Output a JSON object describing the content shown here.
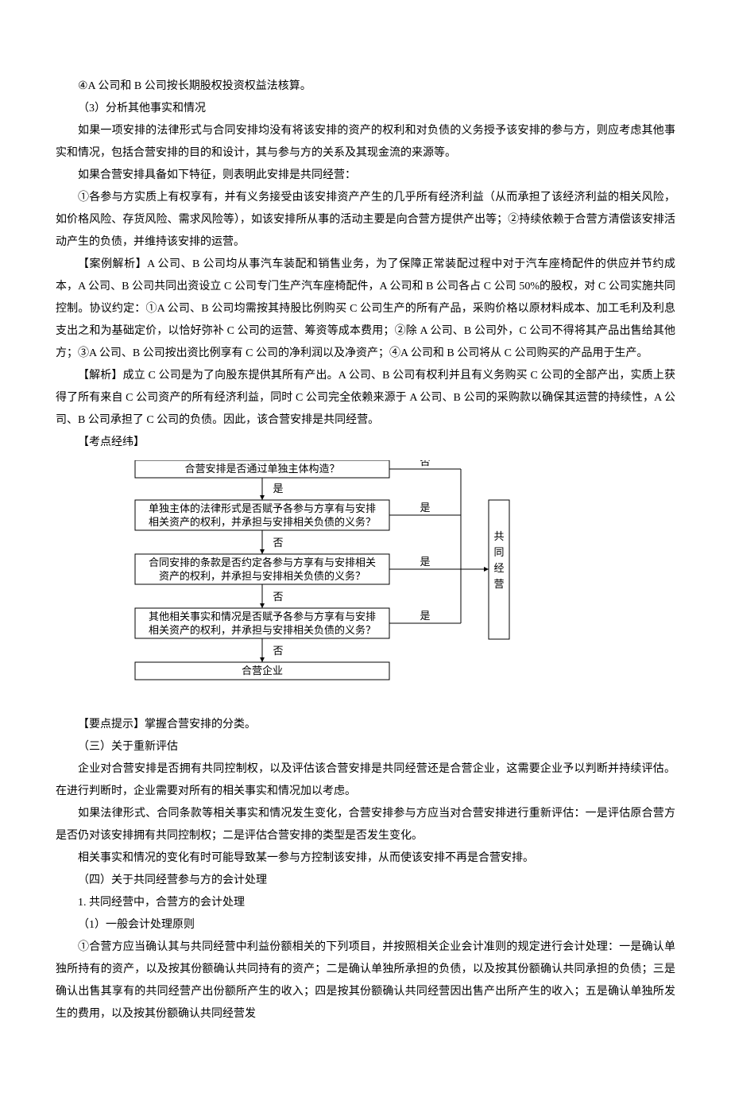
{
  "paragraphs": {
    "p1": "④A 公司和 B 公司按长期股权投资权益法核算。",
    "p2": "（3）分析其他事实和情况",
    "p3": "如果一项安排的法律形式与合同安排均没有将该安排的资产的权利和对负债的义务授予该安排的参与方，则应考虑其他事实和情况，包括合营安排的目的和设计，其与参与方的关系及其现金流的来源等。",
    "p4": "如果合营安排具备如下特征，则表明此安排是共同经营：",
    "p5": "①各参与方实质上有权享有，并有义务接受由该安排资产产生的几乎所有经济利益（从而承担了该经济利益的相关风险，如价格风险、存货风险、需求风险等），如该安排所从事的活动主要是向合营方提供产出等；②持续依赖于合营方清偿该安排活动产生的负债，并维持该安排的运营。",
    "p6": "【案例解析】A 公司、B 公司均从事汽车装配和销售业务，为了保障正常装配过程中对于汽车座椅配件的供应并节约成本，A 公司、B 公司共同出资设立 C 公司专门生产汽车座椅配件，A 公司和 B 公司各占 C 公司 50%的股权，对 C 公司实施共同控制。协议约定：①A 公司、B 公司均需按其持股比例购买 C 公司生产的所有产品，采购价格以原材料成本、加工毛利及利息支出之和为基础定价，以恰好弥补 C 公司的运营、筹资等成本费用；②除 A 公司、B 公司外，C 公司不得将其产品出售给其他方；③A 公司、B 公司按出资比例享有 C 公司的净利润以及净资产；④A 公司和 B 公司将从 C 公司购买的产品用于生产。",
    "p7": "【解析】成立 C 公司是为了向股东提供其所有产出。A 公司、B 公司有权利并且有义务购买 C 公司的全部产出，实质上获得了所有来自 C 公司资产的所有经济利益，同时 C 公司完全依赖来源于 A 公司、B 公司的采购款以确保其运营的持续性，A 公司、B 公司承担了 C 公司的负债。因此，该合营安排是共同经营。",
    "p8": "【考点经纬】",
    "p9": "【要点提示】掌握合营安排的分类。",
    "p10": "（三）关于重新评估",
    "p11": "企业对合营安排是否拥有共同控制权，以及评估该合营安排是共同经营还是合营企业，这需要企业予以判断并持续评估。在进行判断时，企业需要对所有的相关事实和情况加以考虑。",
    "p12": "如果法律形式、合同条款等相关事实和情况发生变化，合营安排参与方应当对合营安排进行重新评估：一是评估原合营方是否仍对该安排拥有共同控制权；二是评估合营安排的类型是否发生变化。",
    "p13": "相关事实和情况的变化有时可能导致某一参与方控制该安排，从而使该安排不再是合营安排。",
    "p14": "（四）关于共同经营参与方的会计处理",
    "p15": "1. 共同经营中，合营方的会计处理",
    "p16": "（1）一般会计处理原则",
    "p17": "①合营方应当确认其与共同经营中利益份额相关的下列项目，并按照相关企业会计准则的规定进行会计处理：一是确认单独所持有的资产，以及按其份额确认共同持有的资产；二是确认单独所承担的负债，以及按其份额确认共同承担的负债；三是确认出售其享有的共同经营产出份额所产生的收入；四是按其份额确认共同经营因出售产出所产生的收入；五是确认单独所发生的费用，以及按其份额确认共同经营发"
  },
  "diagram": {
    "box1": "合营安排是否通过单独主体构造？",
    "box2a": "单独主体的法律形式是否赋予各参与方享有与安排",
    "box2b": "相关资产的权利，并承担与安排相关负债的义务？",
    "box3a": "合同安排的条款是否约定各参与方享有与安排相关",
    "box3b": "资产的权利，并承担与安排相关负债的义务？",
    "box4a": "其他相关事实和情况是否赋予各参与方享有与安排",
    "box4b": "相关资产的权利，并承担与安排相关负债的义务？",
    "box5": "合营企业",
    "right_label": "共同经营",
    "yes": "是",
    "no": "否"
  }
}
